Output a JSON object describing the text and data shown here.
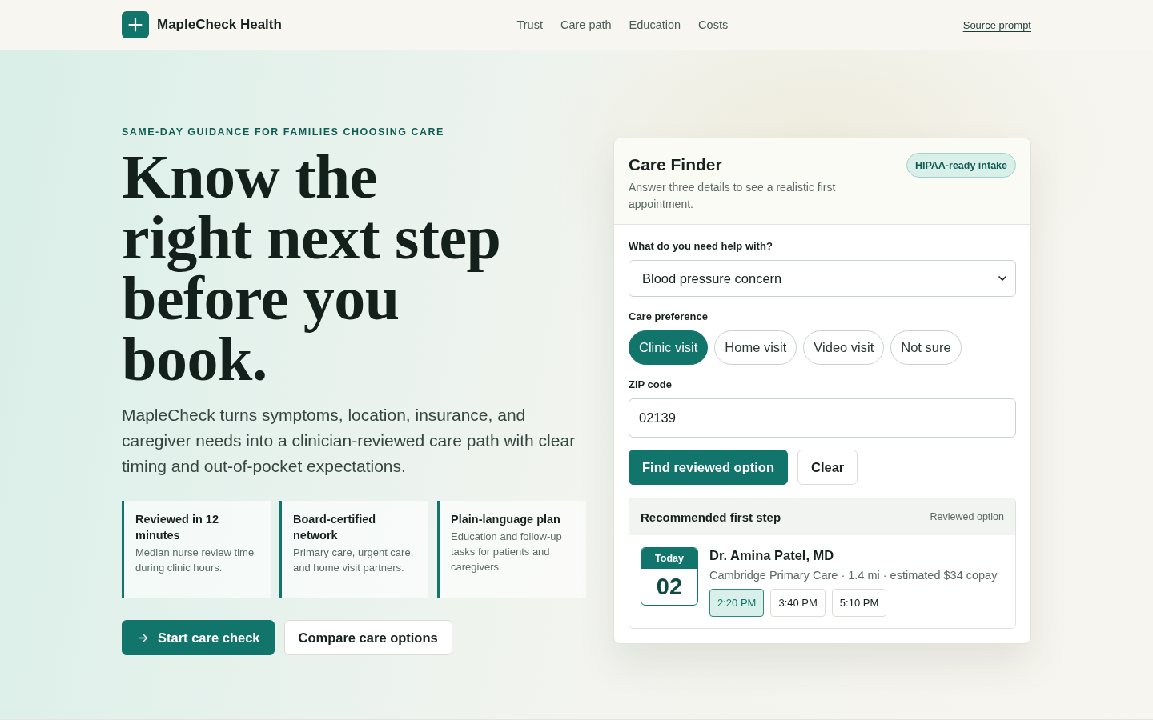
{
  "header": {
    "brand": "MapleCheck Health",
    "nav": [
      {
        "label": "Trust"
      },
      {
        "label": "Care path"
      },
      {
        "label": "Education"
      },
      {
        "label": "Costs"
      }
    ],
    "source_link": "Source prompt"
  },
  "hero": {
    "eyebrow": "SAME-DAY GUIDANCE FOR FAMILIES CHOOSING CARE",
    "headline_lines": [
      "Know the",
      "right next step",
      "before you",
      "book."
    ],
    "lead": "MapleCheck turns symptoms, location, insurance, and caregiver needs into a clinician-reviewed care path with clear timing and out-of-pocket expectations.",
    "features": [
      {
        "title": "Reviewed in 12 minutes",
        "text": "Median nurse review time during clinic hours."
      },
      {
        "title": "Board-certified network",
        "text": "Primary care, urgent care, and home visit partners."
      },
      {
        "title": "Plain-language plan",
        "text": "Education and follow-up tasks for patients and caregivers."
      }
    ],
    "actions": [
      {
        "label": "Start care check",
        "kind": "primary"
      },
      {
        "label": "Compare care options",
        "kind": "secondary"
      }
    ]
  },
  "care_finder": {
    "title": "Care Finder",
    "subtitle": "Answer three details to see a realistic first appointment.",
    "badge": "HIPAA-ready intake",
    "need": {
      "label": "What do you need help with?",
      "value": "Blood pressure concern"
    },
    "preference": {
      "label": "Care preference",
      "options": [
        {
          "label": "Clinic visit",
          "selected": true
        },
        {
          "label": "Home visit",
          "selected": false
        },
        {
          "label": "Video visit",
          "selected": false
        },
        {
          "label": "Not sure",
          "selected": false
        }
      ]
    },
    "zip": {
      "label": "ZIP code",
      "value": "02139"
    },
    "actions": [
      {
        "label": "Find reviewed option",
        "kind": "primary"
      },
      {
        "label": "Clear",
        "kind": "secondary"
      }
    ],
    "result": {
      "title": "Recommended first step",
      "tag": "Reviewed option",
      "date": {
        "label": "Today",
        "day": "02"
      },
      "provider": "Dr. Amina Patel, MD",
      "details": "Cambridge Primary Care · 1.4 mi · estimated $34 copay",
      "slots": [
        {
          "label": "2:20 PM",
          "selected": true
        },
        {
          "label": "3:40 PM",
          "selected": false
        },
        {
          "label": "5:10 PM",
          "selected": false
        }
      ]
    }
  }
}
